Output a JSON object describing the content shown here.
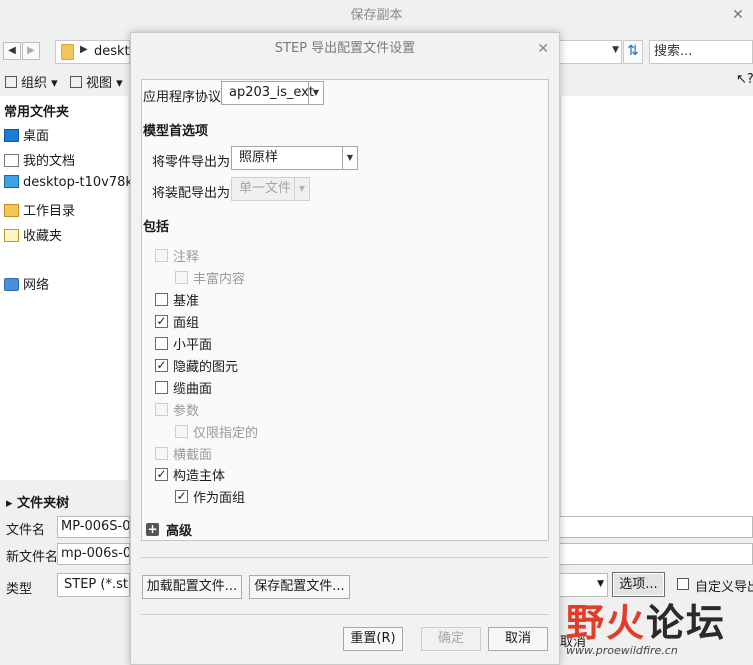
{
  "parent": {
    "title": "保存副本",
    "path": "desktop",
    "search_placeholder": "搜索...",
    "toolbar": {
      "organize": "组织",
      "view": "视图"
    },
    "sidebar": {
      "header": "常用文件夹",
      "items": [
        {
          "label": "桌面",
          "icon": "desktop-icon"
        },
        {
          "label": "我的文档",
          "icon": "documents-icon"
        },
        {
          "label": "desktop-t10v78k",
          "icon": "computer-icon"
        },
        {
          "label": "工作目录",
          "icon": "working-dir-icon"
        },
        {
          "label": "收藏夹",
          "icon": "favorites-icon"
        },
        {
          "label": "网络",
          "icon": "network-icon"
        }
      ]
    },
    "folder_tree": "文件夹树",
    "file_name_label": "文件名",
    "file_name_value": "MP-006S-00",
    "new_name_label": "新文件名",
    "new_name_value": "mp-006s-00",
    "type_label": "类型",
    "type_value": "STEP (*.stp)",
    "options_button": "选项...",
    "custom_export_label": "自定义导出",
    "cancel_tail": "取消"
  },
  "dialog": {
    "title": "STEP 导出配置文件设置",
    "protocol_label": "应用程序协议",
    "protocol_value": "ap203_is_ext",
    "model_prefs_header": "模型首选项",
    "export_parts_label": "将零件导出为",
    "export_parts_value": "照原样",
    "export_asm_label": "将装配导出为",
    "export_asm_value": "单一文件",
    "include_header": "包括",
    "options": [
      {
        "label": "注释",
        "checked": false,
        "enabled": false,
        "indent": 0
      },
      {
        "label": "丰富内容",
        "checked": false,
        "enabled": false,
        "indent": 1
      },
      {
        "label": "基准",
        "checked": false,
        "enabled": true,
        "indent": 0
      },
      {
        "label": "面组",
        "checked": true,
        "enabled": true,
        "indent": 0
      },
      {
        "label": "小平面",
        "checked": false,
        "enabled": true,
        "indent": 0
      },
      {
        "label": "隐藏的图元",
        "checked": true,
        "enabled": true,
        "indent": 0
      },
      {
        "label": "缆曲面",
        "checked": false,
        "enabled": true,
        "indent": 0
      },
      {
        "label": "参数",
        "checked": false,
        "enabled": false,
        "indent": 0
      },
      {
        "label": "仅限指定的",
        "checked": false,
        "enabled": false,
        "indent": 1
      },
      {
        "label": "横截面",
        "checked": false,
        "enabled": false,
        "indent": 0
      },
      {
        "label": "构造主体",
        "checked": true,
        "enabled": true,
        "indent": 0
      },
      {
        "label": "作为面组",
        "checked": true,
        "enabled": true,
        "indent": 1
      }
    ],
    "advanced_label": "高级",
    "load_config_button": "加载配置文件...",
    "save_config_button": "保存配置文件...",
    "reset_button": "重置(R)",
    "ok_button": "确定",
    "cancel_button": "取消"
  },
  "watermark": {
    "red_text": "野火",
    "black_text": "论坛",
    "url": "www.proewildfire.cn"
  }
}
